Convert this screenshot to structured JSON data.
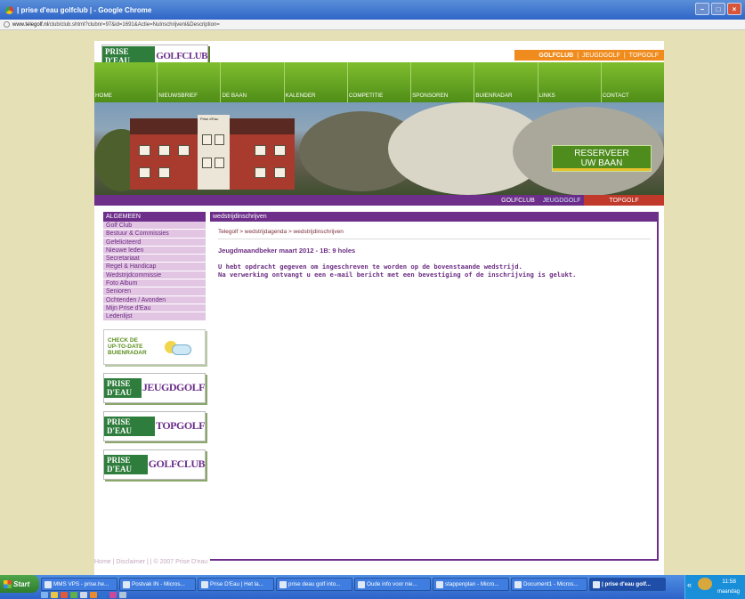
{
  "window": {
    "title": "| prise d'eau golfclub | - Google Chrome",
    "controls": [
      "–",
      "□",
      "×"
    ]
  },
  "address": {
    "domain": "www.telegolf.nl",
    "path": "/club/club.shtml?clubnr=97&id=1691&Actie=NuInschrijvenl&Description="
  },
  "site": {
    "logo_prefix": "PRISE D'EAU",
    "logo_word": "GOLFCLUB",
    "top_links": [
      "GOLFCLUB",
      "JEUGDGOLF",
      "TOPGOLF"
    ],
    "top_sep": "|",
    "main_nav": [
      "HOME",
      "NIEUWSBRIEF",
      "DE BAAN",
      "KALENDER",
      "COMPETITIE",
      "SPONSOREN",
      "BUIENRADAR",
      "LINKS",
      "CONTACT"
    ],
    "reserve": [
      "RESERVEER",
      "UW BAAN"
    ],
    "banner_tabs": [
      "GOLFCLUB",
      "JEUGDGOLF",
      "TOPGOLF"
    ],
    "building_sign": "Prise d'Eau"
  },
  "sidebar": {
    "heading": "ALGEMEEN",
    "items": [
      "Golf Club",
      "Bestuur & Commissies",
      "Gefeliciteerd",
      "Nieuwe leden",
      "Secretariaat",
      "Regel & Handicap",
      "Wedstrijdcommissie",
      "Foto Album",
      "Senioren",
      "Ochtenden / Avonden",
      "Mijn Prise d'Eau",
      "Ledenlijst"
    ],
    "weather_text": [
      "CHECK DE",
      "UP-TO-DATE",
      "BUIENRADAR"
    ],
    "logos": [
      {
        "prefix": "PRISE D'EAU",
        "word": "JEUGDGOLF"
      },
      {
        "prefix": "PRISE D'EAU",
        "word": "TOPGOLF"
      },
      {
        "prefix": "PRISE D'EAU",
        "word": "GOLFCLUB"
      }
    ]
  },
  "content": {
    "heading": "wedstrijdinschrijven",
    "breadcrumb": "Telegolf > wedstrijdagenda > wedstrijdinschrijven",
    "title": "Jeugdmaandbeker maart 2012 - 1B: 9 holes",
    "message_line1": "U hebt opdracht gegeven om ingeschreven te worden op de bovenstaande wedstrijd.",
    "message_line2": "Na verwerking ontvangt u een e-mail bericht met een bevestiging of de inschrijving is gelukt."
  },
  "footer": {
    "text": "Home | Disclaimer | | © 2007 Prise D'eau"
  },
  "taskbar": {
    "start": "Start",
    "tasks": [
      "MMS VPS - prise.he...",
      "Postvak IN - Micros...",
      "Prise D'Eau | Het la...",
      "prise deau golf into...",
      "Oude info voor nie...",
      "stappenplan - Micro...",
      "Document1 - Micros...",
      "| prise d'eau golf..."
    ],
    "clock": "11:58",
    "day": "maandag",
    "chevron": "«"
  },
  "colors": {
    "purple": "#6d2f8a",
    "green": "#5c9f22",
    "orange": "#f08c1e",
    "red": "#c0392b"
  }
}
